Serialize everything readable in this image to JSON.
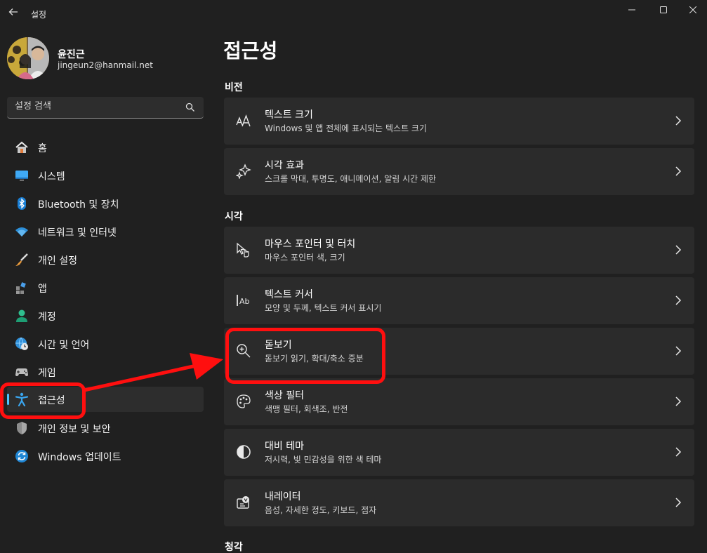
{
  "window": {
    "app_title": "설정",
    "back_icon": "arrow-left-icon",
    "controls": [
      "minimize-icon",
      "maximize-icon",
      "close-icon"
    ]
  },
  "profile": {
    "name": "윤진근",
    "email": "jingeun2@hanmail.net"
  },
  "search": {
    "placeholder": "설정 검색",
    "icon": "search-icon"
  },
  "sidebar": {
    "items": [
      {
        "label": "홈",
        "icon": "home-icon"
      },
      {
        "label": "시스템",
        "icon": "monitor-icon"
      },
      {
        "label": "Bluetooth 및 장치",
        "icon": "bluetooth-icon"
      },
      {
        "label": "네트워크 및 인터넷",
        "icon": "wifi-icon"
      },
      {
        "label": "개인 설정",
        "icon": "brush-icon"
      },
      {
        "label": "앱",
        "icon": "apps-icon"
      },
      {
        "label": "계정",
        "icon": "person-icon"
      },
      {
        "label": "시간 및 언어",
        "icon": "globe-clock-icon"
      },
      {
        "label": "게임",
        "icon": "gamepad-icon"
      },
      {
        "label": "접근성",
        "icon": "accessibility-icon",
        "active": true
      },
      {
        "label": "개인 정보 및 보안",
        "icon": "shield-icon"
      },
      {
        "label": "Windows 업데이트",
        "icon": "update-icon"
      }
    ]
  },
  "main": {
    "title": "접근성",
    "sections": [
      {
        "label": "비전",
        "cards": [
          {
            "title": "텍스트 크기",
            "desc": "Windows 및 앱 전체에 표시되는 텍스트 크기",
            "icon": "text-size-icon"
          },
          {
            "title": "시각 효과",
            "desc": "스크롤 막대, 투명도, 애니메이션, 알림 시간 제한",
            "icon": "sparkle-icon"
          }
        ]
      },
      {
        "label": "시각",
        "cards": [
          {
            "title": "마우스 포인터 및 터치",
            "desc": "마우스 포인터 색, 크기",
            "icon": "pointer-touch-icon"
          },
          {
            "title": "텍스트 커서",
            "desc": "모양 및 두께, 텍스트 커서 표시기",
            "icon": "text-cursor-icon"
          },
          {
            "title": "돋보기",
            "desc": "돋보기 읽기, 확대/축소 증분",
            "icon": "magnifier-icon"
          },
          {
            "title": "색상 필터",
            "desc": "색맹 필터, 회색조, 반전",
            "icon": "palette-icon"
          },
          {
            "title": "대비 테마",
            "desc": "저시력, 빛 민감성을 위한 색 테마",
            "icon": "contrast-icon"
          },
          {
            "title": "내레이터",
            "desc": "음성, 자세한 정도, 키보드, 점자",
            "icon": "narrator-icon"
          }
        ]
      },
      {
        "label": "청각",
        "cards": []
      }
    ]
  },
  "colors": {
    "background": "#202020",
    "card": "#2b2b2b",
    "accent": "#4cc2ff",
    "annotation": "#ff0f0f"
  }
}
